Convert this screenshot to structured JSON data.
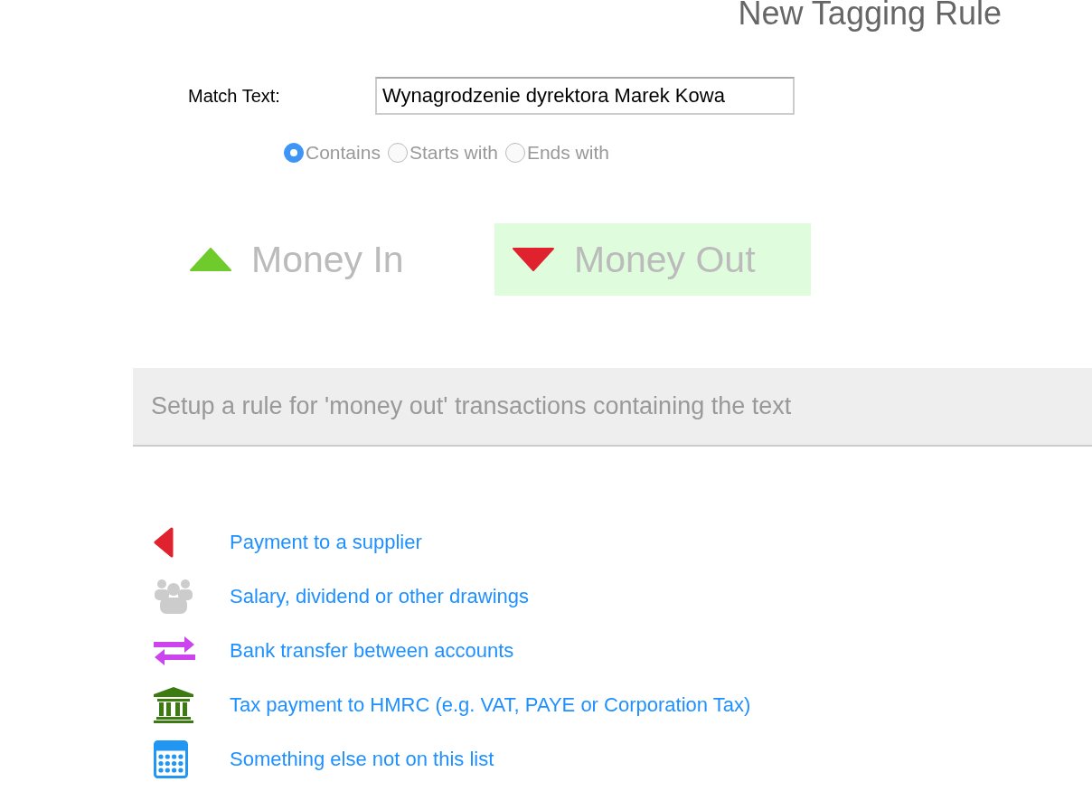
{
  "title": "New Tagging Rule",
  "match": {
    "label": "Match Text:",
    "value": "Wynagrodzenie dyrektora Marek Kowa"
  },
  "match_modes": [
    {
      "label": "Contains",
      "selected": true
    },
    {
      "label": "Starts with",
      "selected": false
    },
    {
      "label": "Ends with",
      "selected": false
    }
  ],
  "directions": [
    {
      "kind": "in",
      "label": "Money In",
      "selected": false
    },
    {
      "kind": "out",
      "label": "Money Out",
      "selected": true
    }
  ],
  "banner": "Setup a rule for 'money out' transactions containing the text",
  "options": [
    {
      "kind": "supplier",
      "label": "Payment to a supplier"
    },
    {
      "kind": "salary",
      "label": "Salary, dividend or other drawings"
    },
    {
      "kind": "transfer",
      "label": "Bank transfer between accounts"
    },
    {
      "kind": "tax",
      "label": "Tax payment to HMRC (e.g. VAT, PAYE or Corporation Tax)"
    },
    {
      "kind": "other",
      "label": "Something else not on this list"
    }
  ]
}
